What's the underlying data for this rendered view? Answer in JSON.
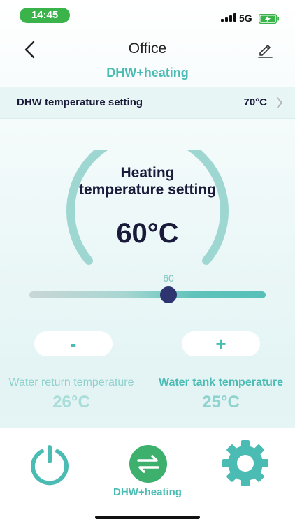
{
  "status": {
    "time": "14:45",
    "network": "5G"
  },
  "header": {
    "title": "Office"
  },
  "mode_title": "DHW+heating",
  "dhw_setting": {
    "label": "DHW temperature setting",
    "value": "70°C"
  },
  "gauge": {
    "title": "Heating temperature setting",
    "value": "60°C"
  },
  "slider": {
    "value": 60,
    "value_label": "60",
    "min": 0,
    "max": 100
  },
  "steppers": {
    "minus": "-",
    "plus": "+"
  },
  "readings": [
    {
      "label": "Water return temperature",
      "value": "26°C"
    },
    {
      "label": "Water tank temperature",
      "value": "25°C"
    }
  ],
  "nav": {
    "active_label": "DHW+heating"
  },
  "colors": {
    "accent": "#4bbcb4",
    "gauge": "#9ed7d2",
    "thumb": "#2d3470",
    "status_green": "#3ab34a"
  },
  "icons": [
    "back-arrow-icon",
    "edit-pencil-icon",
    "chevron-right-icon",
    "power-icon",
    "mode-switch-icon",
    "settings-gear-icon"
  ]
}
